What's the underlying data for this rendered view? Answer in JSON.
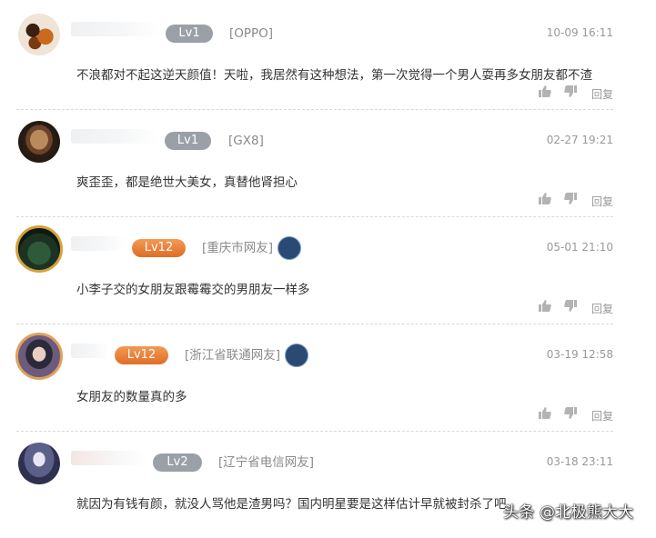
{
  "comments": [
    {
      "level": "Lv1",
      "source": "[OPPO]",
      "time": "10-09 16:11",
      "content": "不浪都对不起这逆天颜值！天啦，我居然有这种想法，第一次觉得一个男人耍再多女朋友都不渣",
      "reply_label": "回复"
    },
    {
      "level": "Lv1",
      "source": "[GX8]",
      "time": "02-27 19:21",
      "content": "爽歪歪，都是绝世大美女，真替他肾担心",
      "reply_label": "回复"
    },
    {
      "level": "Lv12",
      "source": "[重庆市网友]",
      "time": "05-01 21:10",
      "content": "小李子交的女朋友跟霉霉交的男朋友一样多",
      "reply_label": "回复"
    },
    {
      "level": "Lv12",
      "source": "[浙江省联通网友]",
      "time": "03-19 12:58",
      "content": "女朋友的数量真的多",
      "reply_label": "回复"
    },
    {
      "level": "Lv2",
      "source": "[辽宁省电信网友]",
      "time": "03-18 23:11",
      "content": "就因为有钱有颜，就没人骂他是渣男吗？国内明星要是这样估计早就被封杀了吧",
      "reply_label": "回复"
    }
  ],
  "icons": {
    "like": "thumbs-up-icon",
    "dislike": "thumbs-down-icon",
    "platform": "steam-icon"
  },
  "colors": {
    "badge_gray": "#9aa0a6",
    "badge_orange": "#e8772f",
    "meta_text": "#8a8a8a",
    "divider": "#d9d9d9"
  },
  "watermark": "头条 @北极熊大大"
}
